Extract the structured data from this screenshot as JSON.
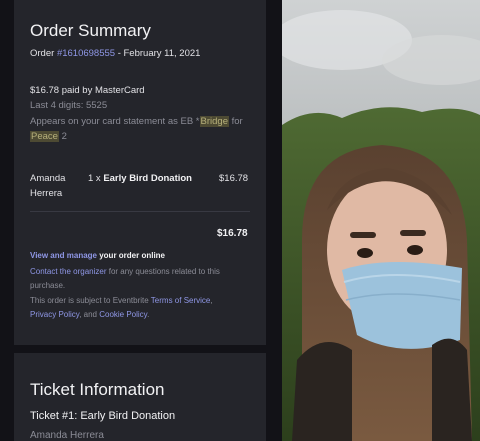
{
  "summary": {
    "title": "Order Summary",
    "order_prefix": "Order ",
    "order_number": "#1610698555",
    "order_date": " - February 11, 2021",
    "paid_line": "$16.78 paid by MasterCard",
    "last4": "Last 4 digits: 5525",
    "statement_1": "Appears on your card statement as EB *",
    "statement_hl1": "Bridge",
    "statement_2": " for",
    "statement_hl2": "Peace",
    "statement_3": " 2",
    "attendee_first": "Amanda",
    "attendee_last": "Herrera",
    "item": "1 x ",
    "item_name": "Early Bird Donation",
    "item_price": "$16.78",
    "total": "$16.78",
    "view_link": "View and manage",
    "view_rest": " your order online",
    "contact_link": "Contact the organizer",
    "contact_rest_1": " for any questions related to this",
    "contact_rest_2": "purchase.",
    "terms_1": "This order is subject to Eventbrite ",
    "terms_link": "Terms of Service",
    "terms_2": ",",
    "privacy_link": "Privacy Policy",
    "privacy_and": ", and ",
    "cookie_link": "Cookie Policy",
    "period": "."
  },
  "ticket": {
    "title": "Ticket Information",
    "ticket_label": "Ticket #1: Early Bird Donation",
    "attendee": "Amanda Herrera"
  },
  "colors": {
    "background": "#121217",
    "card": "#24252b",
    "link": "#8f97e6",
    "highlight": "#4d4a33"
  }
}
